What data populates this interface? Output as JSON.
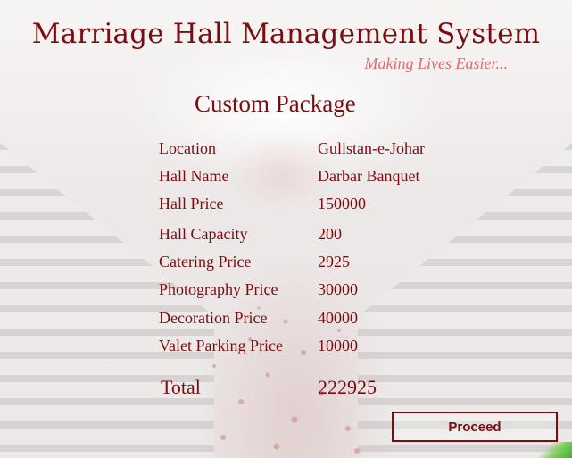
{
  "app": {
    "title": "Marriage Hall Management System",
    "tagline": "Making Lives Easier..."
  },
  "section": {
    "title": "Custom Package"
  },
  "details": [
    {
      "label": "Location",
      "value": "Gulistan-e-Johar"
    },
    {
      "label": "Hall Name",
      "value": "Darbar Banquet"
    },
    {
      "label": "Hall Price",
      "value": "150000"
    },
    {
      "label": "Hall Capacity",
      "value": "200"
    },
    {
      "label": "Catering Price",
      "value": "2925"
    },
    {
      "label": "Photography Price",
      "value": "30000"
    },
    {
      "label": "Decoration Price",
      "value": "40000"
    },
    {
      "label": "Valet Parking Price",
      "value": "10000"
    }
  ],
  "total": {
    "label": "Total",
    "value": "222925"
  },
  "actions": {
    "proceed_label": "Proceed"
  },
  "colors": {
    "accent": "#7a0d12",
    "tagline": "#e06a73"
  }
}
